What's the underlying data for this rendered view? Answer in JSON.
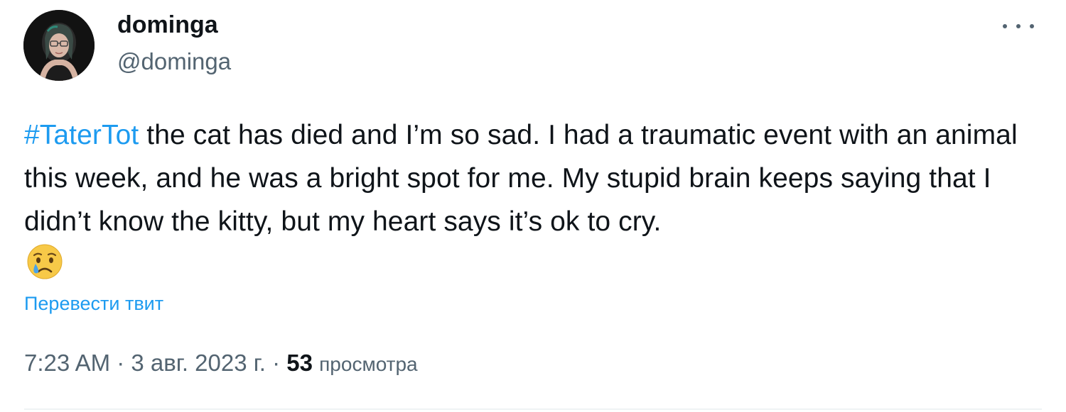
{
  "author": {
    "display_name": "dominga",
    "handle": "@dominga"
  },
  "tweet": {
    "hashtag": "#TaterTot",
    "text": " the cat has died and I’m so sad. I had a traumatic event with an animal this week, and he was a bright spot for me. My stupid brain keeps saying that I didn’t know the kitty, but my heart says it’s ok to cry.",
    "emoji": "crying-face-icon",
    "translate_label": "Перевести твит"
  },
  "meta": {
    "time": "7:23 AM",
    "separator": " · ",
    "date": "3 авг. 2023 г.",
    "views_count": "53",
    "views_label": "просмотра"
  },
  "colors": {
    "link": "#1d9bf0",
    "text": "#0f1419",
    "secondary": "#536471"
  }
}
